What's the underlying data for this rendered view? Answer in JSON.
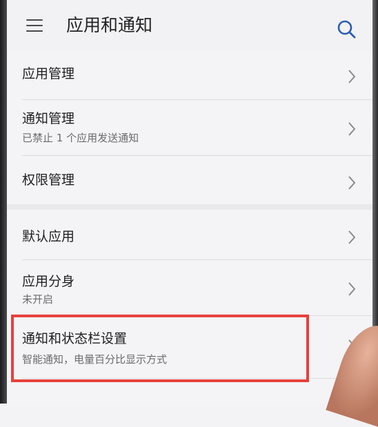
{
  "header": {
    "title": "应用和通知",
    "menu_icon": "hamburger-menu-icon",
    "search_icon": "search-icon"
  },
  "items": [
    {
      "label": "应用管理",
      "subtitle": ""
    },
    {
      "label": "通知管理",
      "subtitle": "已禁止 1 个应用发送通知"
    },
    {
      "label": "权限管理",
      "subtitle": ""
    },
    {
      "label": "默认应用",
      "subtitle": ""
    },
    {
      "label": "应用分身",
      "subtitle": "未开启"
    },
    {
      "label": "通知和状态栏设置",
      "subtitle": "智能通知，电量百分比显示方式"
    }
  ],
  "colors": {
    "highlight_border": "#e8403c",
    "background": "#f4f4f6"
  }
}
